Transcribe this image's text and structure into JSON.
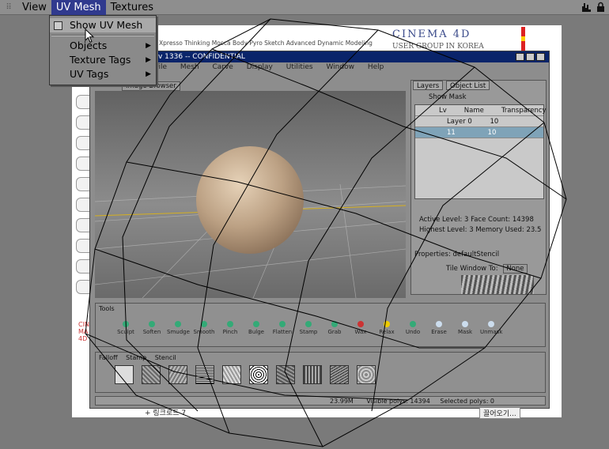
{
  "menubar": {
    "items": [
      "View",
      "UV Mesh",
      "Textures"
    ],
    "active_index": 1
  },
  "uv_menu": {
    "items": [
      {
        "label": "Show UV Mesh",
        "has_icon": true,
        "has_submenu": false
      },
      {
        "label": "Objects",
        "has_icon": false,
        "has_submenu": true
      },
      {
        "label": "Texture Tags",
        "has_icon": false,
        "has_submenu": true
      },
      {
        "label": "UV Tags",
        "has_icon": false,
        "has_submenu": true
      }
    ]
  },
  "screenshot": {
    "brand": "CINEMA 4D",
    "brand_url": "W W W . C I N E M A 4 D . C O . K R",
    "brand_sub": "USER GROUP IN KOREA",
    "web_nav": "Xpresso  Thinking  Mocca  Body  Pyro  Sketch  Advanced  Dynamic  Modeling",
    "c4d_title": "v 1336 -- CONFIDENTIAL",
    "c4d_menu": "File Mesh Carve Display Utilities Window Help",
    "viewport_tab": "Image Browser",
    "tabs": [
      "Layers",
      "Object List"
    ],
    "show_mask": "Show Mask",
    "layer_header": [
      "Lv",
      "Name",
      "Transparency"
    ],
    "layers": [
      {
        "lv": "0",
        "name": "Layer 0",
        "value": "10"
      },
      {
        "lv": "1",
        "name": "11",
        "value": "10"
      }
    ],
    "info_line1": "Active Level: 3    Face Count: 14398",
    "info_line2": "Highest Level: 3  Memory Used: 23.5",
    "props_title": "Properties: defaultStencil",
    "props_label": "Tile Window To:",
    "props_value": "None",
    "props_off": "Off",
    "tools_title": "Tools",
    "tools": [
      "Sculpt",
      "Soften",
      "Smudge",
      "Smooth",
      "Pinch",
      "Bulge",
      "Flatten",
      "Stamp",
      "Grab",
      "Wax",
      "Relax",
      "Undo",
      "Erase",
      "Mask",
      "Unmask"
    ],
    "stamp_tabs": [
      "Falloff",
      "Stamp",
      "Stencil"
    ],
    "status_mem": "23.99M",
    "status_visible": "Visible polys: 14394",
    "status_selected": "Selected polys: 0",
    "bottom_left": "+ 링크로드 7",
    "bottom_right": "끌어오기..."
  },
  "colors": {
    "menu_active": "#303a8e",
    "menu_hover": "#a9a9a9",
    "background": "#7a7a7a",
    "uv_lines": "#000000"
  }
}
